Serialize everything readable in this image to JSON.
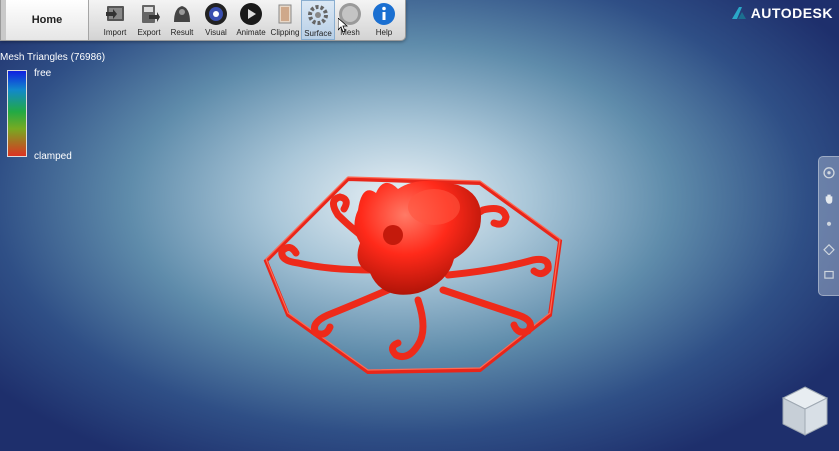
{
  "toolbar": {
    "home_tab": "Home",
    "buttons": [
      {
        "label": "Import",
        "icon": "import-icon"
      },
      {
        "label": "Export",
        "icon": "export-icon"
      },
      {
        "label": "Result",
        "icon": "result-icon"
      },
      {
        "label": "Visual",
        "icon": "visual-icon"
      },
      {
        "label": "Animate",
        "icon": "animate-icon"
      },
      {
        "label": "Clipping",
        "icon": "clipping-icon"
      },
      {
        "label": "Surface",
        "icon": "surface-icon",
        "active": true
      },
      {
        "label": "Mesh",
        "icon": "mesh-icon"
      },
      {
        "label": "Help",
        "icon": "help-icon"
      }
    ]
  },
  "brand": {
    "name": "AUTODESK",
    "logo": "autodesk-logo"
  },
  "legend": {
    "title": "Mesh Triangles (76986)",
    "top_label": "free",
    "bottom_label": "clamped",
    "colors": [
      "#1020e0",
      "#1188cc",
      "#22aa44",
      "#77aa22",
      "#dd3322"
    ]
  },
  "viewport": {
    "model_color": "#ff2a1a",
    "nav_icons": [
      "steering-wheel-icon",
      "pan-hand-icon",
      "orbit-icon",
      "zoom-icon",
      "look-icon"
    ],
    "viewcube": "viewcube-icon"
  }
}
